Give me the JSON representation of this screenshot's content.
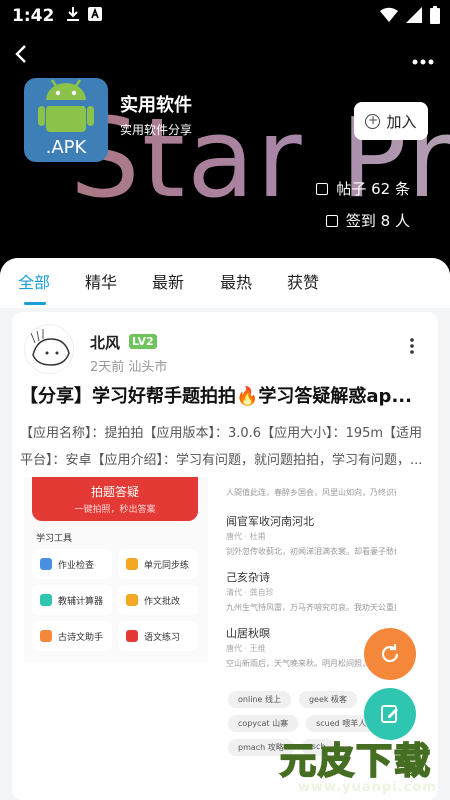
{
  "status_bar": {
    "time": "1:42",
    "icons": [
      "download-icon",
      "a-icon",
      "wifi-icon",
      "signal-icon",
      "battery-icon"
    ]
  },
  "header": {
    "background_text": "Star Pro",
    "app_icon_label": ".APK",
    "title": "实用软件",
    "subtitle": "实用软件分享",
    "join_label": "加入",
    "posts_stat": "帖子 62 条",
    "checkin_stat": "签到 8 人"
  },
  "tabs": [
    {
      "label": "全部",
      "active": true
    },
    {
      "label": "精华",
      "active": false
    },
    {
      "label": "最新",
      "active": false
    },
    {
      "label": "最热",
      "active": false
    },
    {
      "label": "获赞",
      "active": false
    }
  ],
  "post": {
    "author": "北风",
    "level": "LV2",
    "meta": "2天前 汕头市",
    "title": "【分享】学习好帮手题拍拍🔥学习答疑解惑ap...",
    "body": "【应用名称】：提拍拍【应用版本】：3.0.6【应用大小】：195m【适用平台】：安卓【应用介绍】：学习有问题，就问题拍拍，学习有问题，...",
    "left_image": {
      "banner_title": "拍题答疑",
      "banner_sub": "一键拍照，秒出答案",
      "tools_heading": "学习工具",
      "tools": [
        "作业检查",
        "单元同步练",
        "教辅计算器",
        "作文批改",
        "古诗文助手",
        "语文练习"
      ]
    },
    "right_image": {
      "top_line": "人間值此连，春醉乡国会，风里山如向，乃终识得",
      "poems": [
        {
          "title": "闻官军收河南河北",
          "sub": "唐代 · 杜甫",
          "line": "剑外忽传收蓟北，初闻涕泪满衣裳。却看妻子愁何在"
        },
        {
          "title": "己亥杂诗",
          "sub": "清代 · 龚自珍",
          "line": "九州生气恃风雷，万马齐喑究可哀。我劝天公重抖擞"
        },
        {
          "title": "山居秋暝",
          "sub": "唐代 · 王维",
          "line": "空山新雨后，天气晚来秋。明月松间照，清泉石上流"
        }
      ],
      "tags_row1": [
        "online 线上",
        "geek 极客"
      ],
      "tags_row2": [
        "copycat 山寨",
        "scued 喂羊人生"
      ],
      "tags_row3": [
        "pmach 攻略",
        "sch"
      ]
    }
  },
  "fabs": {
    "refresh": "refresh-icon",
    "edit": "edit-icon"
  },
  "watermark": {
    "text": "元皮下载",
    "url": "www.yuanpi.com"
  },
  "colors": {
    "accent": "#1aa0d8",
    "level": "#6ec35a",
    "fab_refresh": "#f5873b",
    "fab_edit": "#2ec6b1",
    "banner": "#e53935"
  }
}
